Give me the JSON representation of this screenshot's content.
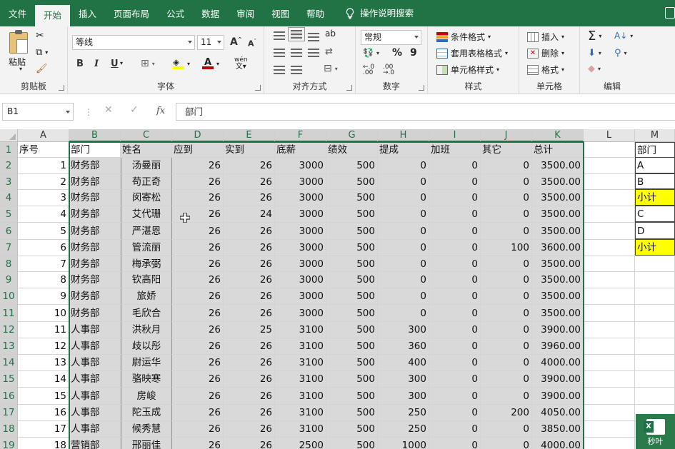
{
  "tabs": [
    "文件",
    "开始",
    "插入",
    "页面布局",
    "公式",
    "数据",
    "审阅",
    "视图",
    "帮助"
  ],
  "active_tab": "开始",
  "search_label": "操作说明搜索",
  "ribbon": {
    "clipboard": {
      "paste": "粘贴",
      "label": "剪贴板"
    },
    "font": {
      "name": "等线",
      "size": "11",
      "label": "字体",
      "grow": "A",
      "shrink": "A",
      "bold": "B",
      "italic": "I",
      "underline": "U",
      "phonetic": "wén"
    },
    "alignment": {
      "label": "对齐方式",
      "wrap": "ab"
    },
    "number": {
      "format": "常规",
      "label": "数字",
      "percent": "%",
      "comma": "9"
    },
    "styles": {
      "conditional": "条件格式",
      "table": "套用表格格式",
      "cell": "单元格样式",
      "label": "样式"
    },
    "cells": {
      "insert": "插入",
      "delete": "删除",
      "format": "格式",
      "label": "单元格"
    },
    "editing": {
      "label": "编辑",
      "sum": "Σ"
    }
  },
  "formula_bar": {
    "name_box": "B1",
    "content": "部门",
    "fx": "fx"
  },
  "columns": [
    "A",
    "B",
    "C",
    "D",
    "E",
    "F",
    "G",
    "H",
    "I",
    "J",
    "K",
    "L",
    "M"
  ],
  "rows": [
    [
      "序号",
      "部门",
      "姓名",
      "应到",
      "实到",
      "底薪",
      "绩效",
      "提成",
      "加班",
      "其它",
      "总计"
    ],
    [
      "1",
      "财务部",
      "汤曼丽",
      "26",
      "26",
      "3000",
      "500",
      "0",
      "0",
      "0",
      "3500.00"
    ],
    [
      "2",
      "财务部",
      "苟正奇",
      "26",
      "26",
      "3000",
      "500",
      "0",
      "0",
      "0",
      "3500.00"
    ],
    [
      "3",
      "财务部",
      "闵寄松",
      "26",
      "26",
      "3000",
      "500",
      "0",
      "0",
      "0",
      "3500.00"
    ],
    [
      "4",
      "财务部",
      "艾代珊",
      "26",
      "24",
      "3000",
      "500",
      "0",
      "0",
      "0",
      "3500.00"
    ],
    [
      "5",
      "财务部",
      "严湛恩",
      "26",
      "26",
      "3000",
      "500",
      "0",
      "0",
      "0",
      "3500.00"
    ],
    [
      "6",
      "财务部",
      "管流丽",
      "26",
      "26",
      "3000",
      "500",
      "0",
      "0",
      "100",
      "3600.00"
    ],
    [
      "7",
      "财务部",
      "梅承弼",
      "26",
      "26",
      "3000",
      "500",
      "0",
      "0",
      "0",
      "3500.00"
    ],
    [
      "8",
      "财务部",
      "钦高阳",
      "26",
      "26",
      "3000",
      "500",
      "0",
      "0",
      "0",
      "3500.00"
    ],
    [
      "9",
      "财务部",
      "旅娇",
      "26",
      "26",
      "3000",
      "500",
      "0",
      "0",
      "0",
      "3500.00"
    ],
    [
      "10",
      "财务部",
      "毛欣合",
      "26",
      "26",
      "3000",
      "500",
      "0",
      "0",
      "0",
      "3500.00"
    ],
    [
      "11",
      "人事部",
      "洪秋月",
      "26",
      "25",
      "3100",
      "500",
      "300",
      "0",
      "0",
      "3900.00"
    ],
    [
      "12",
      "人事部",
      "歧以彤",
      "26",
      "26",
      "3100",
      "500",
      "360",
      "0",
      "0",
      "3960.00"
    ],
    [
      "13",
      "人事部",
      "尉运华",
      "26",
      "26",
      "3100",
      "500",
      "400",
      "0",
      "0",
      "4000.00"
    ],
    [
      "14",
      "人事部",
      "骆映寒",
      "26",
      "26",
      "3100",
      "500",
      "300",
      "0",
      "0",
      "3900.00"
    ],
    [
      "15",
      "人事部",
      "房峻",
      "26",
      "26",
      "3100",
      "500",
      "300",
      "0",
      "0",
      "3900.00"
    ],
    [
      "16",
      "人事部",
      "陀玉成",
      "26",
      "26",
      "3100",
      "500",
      "250",
      "0",
      "200",
      "4050.00"
    ],
    [
      "17",
      "人事部",
      "候秀慧",
      "26",
      "26",
      "3100",
      "500",
      "250",
      "0",
      "0",
      "3850.00"
    ],
    [
      "18",
      "营销部",
      "邢丽佳",
      "26",
      "26",
      "2500",
      "500",
      "1000",
      "0",
      "0",
      "4000.00"
    ]
  ],
  "side_table": [
    {
      "text": "部门",
      "highlight": false
    },
    {
      "text": "A",
      "highlight": false
    },
    {
      "text": "B",
      "highlight": false
    },
    {
      "text": "小计",
      "highlight": true
    },
    {
      "text": "C",
      "highlight": false
    },
    {
      "text": "D",
      "highlight": false
    },
    {
      "text": "小计",
      "highlight": true
    }
  ],
  "brand": "秒叶",
  "colors": {
    "accent": "#217346",
    "highlight": "#ffff00",
    "selection": "#d9d9d9"
  }
}
